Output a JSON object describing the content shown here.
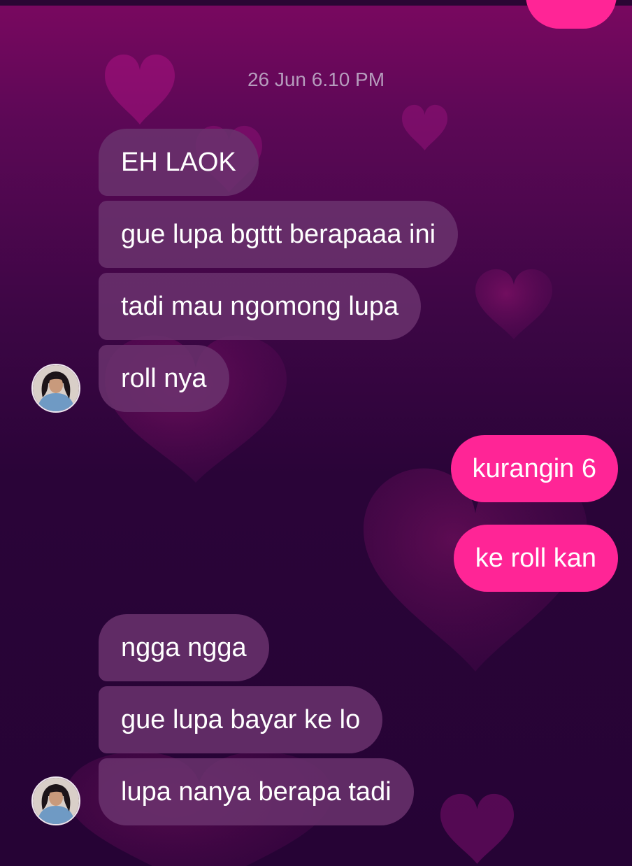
{
  "chat": {
    "timestamp": "26 Jun 6.10 PM",
    "incoming_group_1": [
      "EH LAOK",
      "gue lupa bgttt berapaaa ini",
      "tadi mau ngomong lupa",
      "roll nya"
    ],
    "outgoing": [
      "kurangin 6",
      "ke roll kan"
    ],
    "incoming_group_2": [
      "ngga ngga",
      "gue lupa bayar ke lo",
      "lupa nanya berapa tadi"
    ]
  },
  "colors": {
    "incoming_bubble": "#6a326e",
    "outgoing_bubble": "#ff2596",
    "timestamp_text": "#b69cbd",
    "background_top": "#7a0860",
    "background_bottom": "#260335"
  },
  "icons": {
    "avatar": "contact-avatar",
    "background_decor": "heart-icon"
  }
}
